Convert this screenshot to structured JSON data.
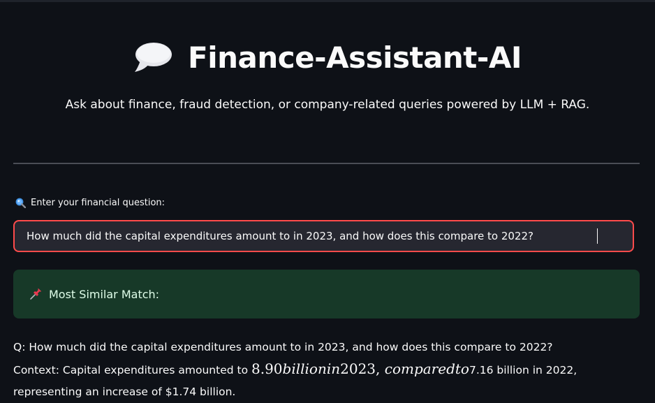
{
  "header": {
    "title": "Finance-Assistant-AI",
    "title_icon": "speech-bubble-icon",
    "subtitle": "Ask about finance, fraud detection, or company-related queries powered by LLM + RAG."
  },
  "question": {
    "label": "Enter your financial question:",
    "label_icon": "magnifier-icon",
    "value": "How much did the capital expenditures amount to in 2023, and how does this compare to 2022?"
  },
  "match": {
    "icon": "pushpin-icon",
    "label": "Most Similar Match:"
  },
  "result": {
    "q_line": "Q: How much did the capital expenditures amount to in 2023, and how does this compare to 2022?",
    "context_prefix": "Context: Capital expenditures amounted to ",
    "math_num": "8.90",
    "math_italic_1": "billionin",
    "math_year": "2023",
    "math_comma": ", ",
    "math_italic_2": "comparedto",
    "context_suffix": "7.16 billion in 2022,",
    "line3": "representing an increase of $1.74 billion."
  },
  "colors": {
    "background": "#0e1117",
    "input_border": "#ff4b4b",
    "input_bg": "#262730",
    "match_bg": "#173928",
    "match_text": "#dffde9"
  }
}
